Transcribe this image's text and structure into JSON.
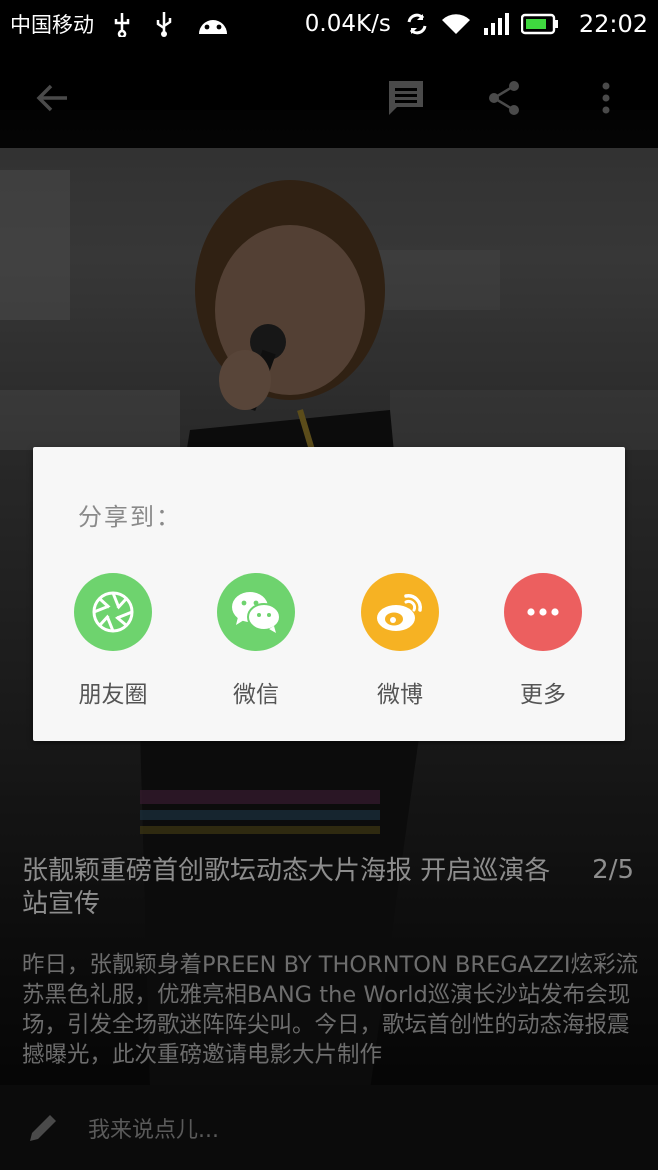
{
  "status_bar": {
    "carrier": "中国移动",
    "net_speed": "0.04K/s",
    "time": "22:02",
    "icons": [
      "usb-debug-icon",
      "usb-icon",
      "android-icon",
      "sync-icon",
      "wifi-icon",
      "signal-icon",
      "battery-icon"
    ]
  },
  "app_bar": {
    "icons": [
      "back-arrow-icon",
      "comment-icon",
      "share-icon",
      "more-vert-icon"
    ]
  },
  "article": {
    "title": "张靓颖重磅首创歌坛动态大片海报 开启巡演各站宣传",
    "counter": "2/5",
    "body": "昨日，张靓颖身着PREEN BY THORNTON BREGAZZI炫彩流苏黑色礼服，优雅亮相BANG the World巡演长沙站发布会现场，引发全场歌迷阵阵尖叫。今日，歌坛首创性的动态海报震撼曝光，此次重磅邀请电影大片制作"
  },
  "comment_bar": {
    "placeholder": "我来说点儿..."
  },
  "share_dialog": {
    "title": "分享到：",
    "options": [
      {
        "label": "朋友圈",
        "icon": "moments-icon",
        "color": "#6ed36e"
      },
      {
        "label": "微信",
        "icon": "wechat-icon",
        "color": "#6ed36e"
      },
      {
        "label": "微博",
        "icon": "weibo-icon",
        "color": "#f6b223"
      },
      {
        "label": "更多",
        "icon": "more-icon",
        "color": "#ec5f5f"
      }
    ]
  },
  "colors": {
    "status_bar_bg": "#000000",
    "dialog_bg": "#f7f7f7",
    "green": "#6ed36e",
    "orange": "#f6b223",
    "red": "#ec5f5f"
  }
}
